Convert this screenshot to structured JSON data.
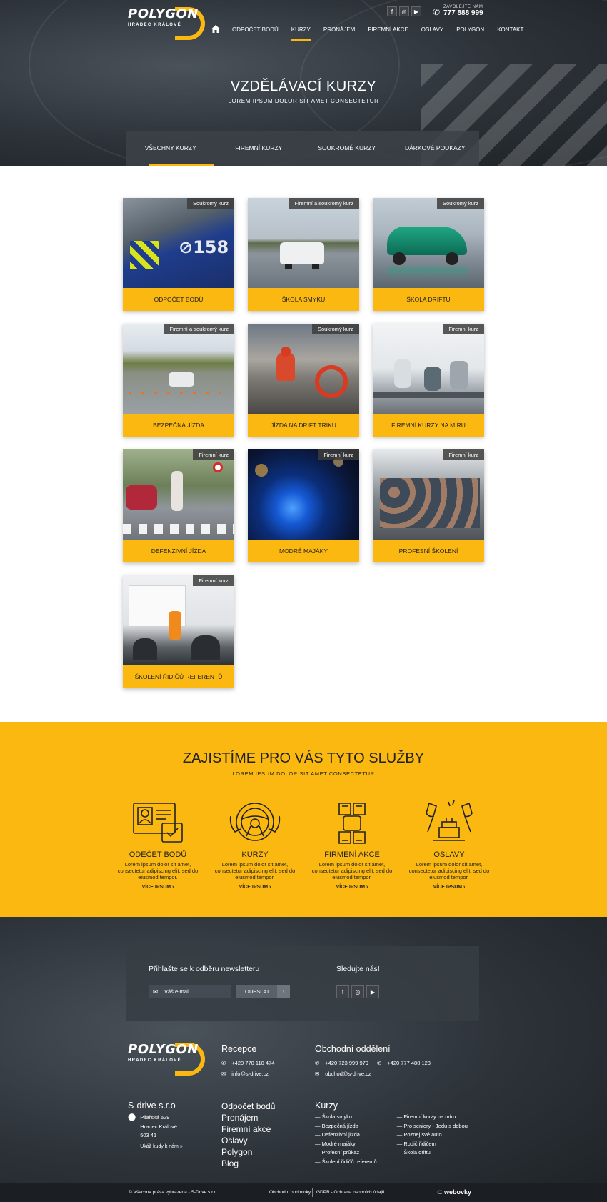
{
  "colors": {
    "accent": "#fbb811",
    "dark": "#2c3238"
  },
  "header": {
    "logo_word": "POLYGON",
    "logo_sub": "HRADEC KRÁLOVÉ",
    "nav": [
      "ODPOČET BODŮ",
      "KURZY",
      "PRONÁJEM",
      "FIREMNÍ AKCE",
      "OSLAVY",
      "POLYGON",
      "KONTAKT"
    ],
    "active_nav": "KURZY",
    "phone_label": "ZAVOLEJTE NÁM",
    "phone": "777 888 999",
    "social": [
      "facebook-icon",
      "instagram-icon",
      "youtube-icon"
    ]
  },
  "hero": {
    "title": "VZDĚLÁVACÍ KURZY",
    "subtitle": "LOREM IPSUM DOLOR SIT AMET CONSECTETUR",
    "tabs": [
      "VŠECHNY KURZY",
      "FIREMNÍ KURZY",
      "SOUKROMÉ KURZY",
      "DÁRKOVÉ POUKAZY"
    ],
    "active_tab": "VŠECHNY KURZY"
  },
  "courses": [
    {
      "tag": "Soukromý kurz",
      "label": "ODPOČET BODŮ",
      "image": "police-car"
    },
    {
      "tag": "Firemní a soukromý kurz",
      "label": "ŠKOLA SMYKU",
      "image": "white-suv-skid"
    },
    {
      "tag": "Soukromý kurz",
      "label": "ŠKOLA DRIFTU",
      "image": "green-bmw"
    },
    {
      "tag": "Firemní a soukromý kurz",
      "label": "BEZPEČNÁ JÍZDA",
      "image": "car-on-track"
    },
    {
      "tag": "Soukromý kurz",
      "label": "JÍZDA NA DRIFT TRIKU",
      "image": "drift-trike"
    },
    {
      "tag": "Firemní kurz",
      "label": "FIREMNÍ KURZY NA MÍRU",
      "image": "classroom"
    },
    {
      "tag": "Firemní kurz",
      "label": "DEFENZIVNÍ JÍZDA",
      "image": "pedestrian-crossing"
    },
    {
      "tag": "Firemní kurz",
      "label": "MODRÉ MAJÁKY",
      "image": "blue-lights"
    },
    {
      "tag": "Firemní kurz",
      "label": "PROFESNÍ ŠKOLENÍ",
      "image": "audience"
    },
    {
      "tag": "Firemní kurz",
      "label": "ŠKOLENÍ ŘIDIČŮ REFERENTŮ",
      "image": "presentation"
    }
  ],
  "services": {
    "title": "ZAJISTÍME PRO VÁS TYTO SLUŽBY",
    "subtitle": "LOREM IPSUM DOLOR SIT AMET CONSECTETUR",
    "items": [
      {
        "title": "ODEČET BODŮ",
        "text": "Lorem ipsum dolor sit amet, consectetur adipiscing elit, sed do eiusmod tempor.",
        "more": "VÍCE IPSUM",
        "icon": "id-card-icon"
      },
      {
        "title": "KURZY",
        "text": "Lorem ipsum dolor sit amet, consectetur adipiscing elit, sed do eiusmod tempor.",
        "more": "VÍCE IPSUM",
        "icon": "steering-wheel-icon"
      },
      {
        "title": "FIRMENÍ AKCE",
        "text": "Lorem ipsum dolor sit amet, consectetur adipiscing elit, sed do eiusmod tempor.",
        "more": "VÍCE IPSUM",
        "icon": "hands-icon"
      },
      {
        "title": "OSLAVY",
        "text": "Lorem ipsum dolor sit amet, consectetur adipiscing elit, sed do eiusmod tempor.",
        "more": "VÍCE IPSUM",
        "icon": "cake-icon"
      }
    ]
  },
  "newsletter": {
    "title": "Přihlašte se k odběru newsletteru",
    "placeholder": "Váš e-mail",
    "submit": "ODESLAT",
    "follow": "Sledujte nás!"
  },
  "footer": {
    "reception": {
      "title": "Recepce",
      "phone": "+420 770 110 474",
      "email": "info@s-drive.cz"
    },
    "sales": {
      "title": "Obchodní oddělení",
      "phone1": "+420 723 999 979",
      "phone2": "+420 777 480 123",
      "email": "obchod@s-drive.cz"
    },
    "company": {
      "name": "S-drive s.r.o",
      "street": "Pilařská 529",
      "city": "Hradec Králové",
      "zip": "503 41",
      "map": "Ukáž kudy k nám »"
    },
    "links": [
      "Odpočet bodů",
      "Pronájem",
      "Firemní akce",
      "Oslavy",
      "Polygon",
      "Blog"
    ],
    "courses_title": "Kurzy",
    "courses_a": [
      "Škola smyku",
      "Bezpečná jízda",
      "Defenzivní jízda",
      "Modré majáky",
      "Profesní průkaz",
      "Školení řidičů referentů"
    ],
    "courses_b": [
      "Firemní kurzy na míru",
      "Pro seniory - Jedu s dobou",
      "Poznej své auto",
      "Rodič řidičem",
      "Škola driftu"
    ],
    "copyright": "Všechna práva vyhrazena - S-Drive s.r.o.",
    "terms": "Obchodní podmínky",
    "gdpr": "GDPR - Ochrana osobních údajů",
    "made_by": "webovky"
  }
}
